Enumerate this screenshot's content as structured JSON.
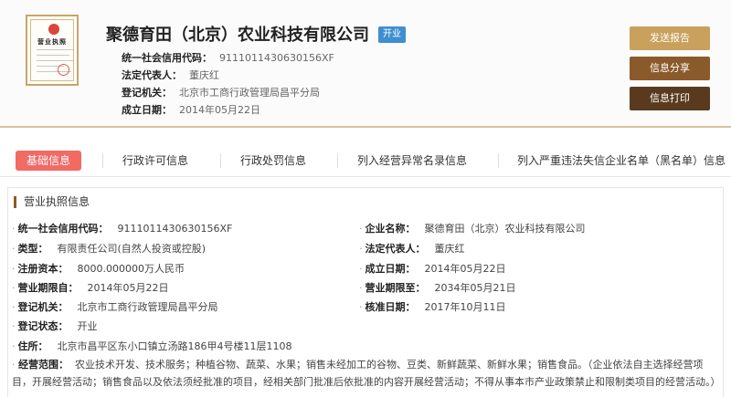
{
  "header": {
    "license_text": "营业执照",
    "company_name": "聚德育田（北京）农业科技有限公司",
    "status": "开业",
    "info": [
      {
        "label": "统一社会信用代码：",
        "value": "911101143063015­6XF"
      },
      {
        "label": "法定代表人：",
        "value": "董庆红"
      },
      {
        "label": "登记机关：",
        "value": "北京市工商行政管理局昌平分局"
      },
      {
        "label": "成立日期：",
        "value": "2014年05月22日"
      }
    ],
    "buttons": {
      "report": "发送报告",
      "share": "信息分享",
      "print": "信息打印"
    }
  },
  "tabs": [
    {
      "label": "基础信息",
      "active": true
    },
    {
      "label": "行政许可信息"
    },
    {
      "label": "行政处罚信息"
    },
    {
      "label": "列入经营异常名录信息"
    },
    {
      "label": "列入严重违法失信企业名单（黑名单）信息"
    }
  ],
  "section": {
    "title": "营业执照信息",
    "left": [
      {
        "label": "统一社会信用代码：",
        "value": "911101143063015­6XF"
      },
      {
        "label": "类型：",
        "value": "有限责任公司(自然人投资或控股)"
      },
      {
        "label": "注册资本：",
        "value": "8000.000000万人民币"
      },
      {
        "label": "营业期限自：",
        "value": "2014年05月22日"
      },
      {
        "label": "登记机关：",
        "value": "北京市工商行政管理局昌平分局"
      },
      {
        "label": "登记状态：",
        "value": "开业"
      },
      {
        "label": "住所：",
        "value": "北京市昌平区东小口镇立汤路186甲4号楼11层1108"
      }
    ],
    "right": [
      {
        "label": "企业名称：",
        "value": "聚德育田（北京）农业科技有限公司"
      },
      {
        "label": "法定代表人：",
        "value": "董庆红"
      },
      {
        "label": "成立日期：",
        "value": "2014年05月22日"
      },
      {
        "label": "营业期限至：",
        "value": "2034年05月21日"
      },
      {
        "label": "核准日期：",
        "value": "2017年10月11日"
      }
    ],
    "scope_label": "经营范围：",
    "scope_value": "农业技术开发、技术服务；种植谷物、蔬菜、水果；销售未经加工的谷物、豆类、新鲜蔬菜、新鲜水果；销售食品。（企业依法自主选择经营项目，开展经营活动；销售食品以及依法须经批准的项目，经相关部门批准后依批准的内容开展经营活动；不得从事本市产业政策禁止和限制类项目的经营活动。）"
  }
}
